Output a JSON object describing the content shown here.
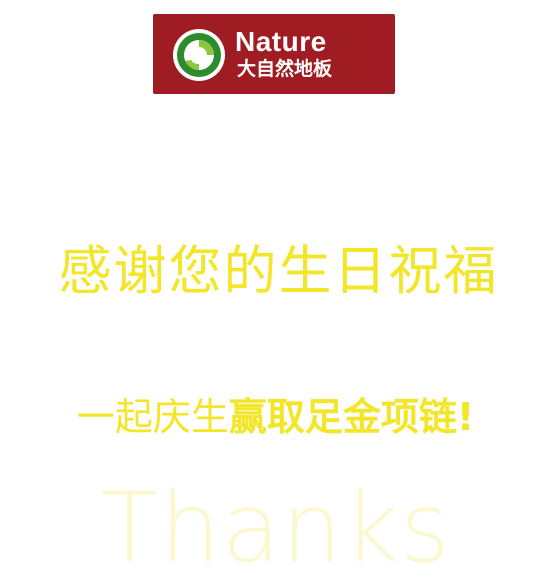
{
  "logo": {
    "brand_en": "Nature",
    "brand_cn": "大自然地板",
    "registered_mark": "®",
    "bg_color": "#9e1c22",
    "mark_colors": [
      "#2e8b2e",
      "#8cc63f"
    ]
  },
  "headline": {
    "text": "感谢您的生日祝福",
    "color": "#f3e629"
  },
  "subline": {
    "light_text": "一起庆生",
    "bold_text": "赢取足金项链!",
    "color": "#f3e629"
  },
  "watermark": {
    "text": "Thanks",
    "color": "#fbf7c8"
  }
}
